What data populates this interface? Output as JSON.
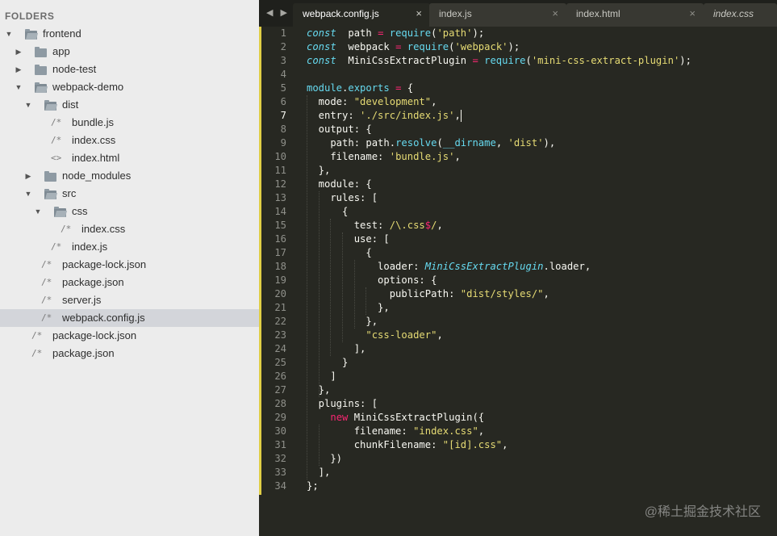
{
  "sidebar": {
    "title": "FOLDERS",
    "tree": [
      {
        "label": "frontend",
        "type": "folder",
        "depth": 0,
        "open": true
      },
      {
        "label": "app",
        "type": "folder",
        "depth": 1,
        "open": false
      },
      {
        "label": "node-test",
        "type": "folder",
        "depth": 1,
        "open": false
      },
      {
        "label": "webpack-demo",
        "type": "folder",
        "depth": 1,
        "open": true
      },
      {
        "label": "dist",
        "type": "folder",
        "depth": 2,
        "open": true
      },
      {
        "label": "bundle.js",
        "type": "file",
        "icon": "/*",
        "depth": 3
      },
      {
        "label": "index.css",
        "type": "file",
        "icon": "/*",
        "depth": 3
      },
      {
        "label": "index.html",
        "type": "file",
        "icon": "<>",
        "depth": 3
      },
      {
        "label": "node_modules",
        "type": "folder",
        "depth": 2,
        "open": false
      },
      {
        "label": "src",
        "type": "folder",
        "depth": 2,
        "open": true
      },
      {
        "label": "css",
        "type": "folder",
        "depth": 3,
        "open": true
      },
      {
        "label": "index.css",
        "type": "file",
        "icon": "/*",
        "depth": 4
      },
      {
        "label": "index.js",
        "type": "file",
        "icon": "/*",
        "depth": 3
      },
      {
        "label": "package-lock.json",
        "type": "file",
        "icon": "/*",
        "depth": 2
      },
      {
        "label": "package.json",
        "type": "file",
        "icon": "/*",
        "depth": 2
      },
      {
        "label": "server.js",
        "type": "file",
        "icon": "/*",
        "depth": 2
      },
      {
        "label": "webpack.config.js",
        "type": "file",
        "icon": "/*",
        "depth": 2,
        "selected": true
      },
      {
        "label": "package-lock.json",
        "type": "file",
        "icon": "/*",
        "depth": 1
      },
      {
        "label": "package.json",
        "type": "file",
        "icon": "/*",
        "depth": 1
      }
    ]
  },
  "tabbar": {
    "nav_arrows": "◀ ▶",
    "tabs": [
      {
        "label": "webpack.config.js",
        "close": "×",
        "active": true
      },
      {
        "label": "index.js",
        "close": "×"
      },
      {
        "label": "index.html",
        "close": "×"
      },
      {
        "label": "index.css",
        "close": "×",
        "italic": true
      }
    ]
  },
  "editor": {
    "current_line": 7,
    "lines": [
      [
        [
          "kw",
          "const"
        ],
        [
          "",
          "  path "
        ],
        [
          "op",
          "="
        ],
        [
          "",
          ""
        ],
        [
          "fn",
          " require"
        ],
        [
          "",
          "("
        ],
        [
          "str",
          "'path'"
        ],
        [
          "",
          ");"
        ]
      ],
      [
        [
          "kw",
          "const"
        ],
        [
          "",
          "  webpack "
        ],
        [
          "op",
          "="
        ],
        [
          "fn",
          " require"
        ],
        [
          "",
          "("
        ],
        [
          "str",
          "'webpack'"
        ],
        [
          "",
          ");"
        ]
      ],
      [
        [
          "kw",
          "const"
        ],
        [
          "",
          "  MiniCssExtractPlugin "
        ],
        [
          "op",
          "="
        ],
        [
          "fn",
          " require"
        ],
        [
          "",
          "("
        ],
        [
          "str",
          "'mini-css-extract-plugin'"
        ],
        [
          "",
          ");"
        ]
      ],
      [],
      [
        [
          "fn",
          "module"
        ],
        [
          "",
          "."
        ],
        [
          "fn",
          "exports"
        ],
        [
          "op",
          " ="
        ],
        [
          "",
          " {"
        ]
      ],
      [
        [
          "",
          "  mode: "
        ],
        [
          "str",
          "\"development\""
        ],
        [
          "",
          ","
        ]
      ],
      [
        [
          "",
          "  entry: "
        ],
        [
          "str",
          "'./src/index.js'"
        ],
        [
          "",
          ","
        ],
        [
          "cursor",
          ""
        ]
      ],
      [
        [
          "",
          "  output: {"
        ]
      ],
      [
        [
          "",
          "    path: path."
        ],
        [
          "fn",
          "resolve"
        ],
        [
          "",
          "("
        ],
        [
          "fn",
          "__dirname"
        ],
        [
          "",
          ", "
        ],
        [
          "str",
          "'dist'"
        ],
        [
          "",
          "),"
        ]
      ],
      [
        [
          "",
          "    filename: "
        ],
        [
          "str",
          "'bundle.js'"
        ],
        [
          "",
          ","
        ]
      ],
      [
        [
          "",
          "  },"
        ]
      ],
      [
        [
          "",
          "  module: {"
        ]
      ],
      [
        [
          "",
          "    rules: ["
        ]
      ],
      [
        [
          "",
          "      {"
        ]
      ],
      [
        [
          "",
          "        test: "
        ],
        [
          "str",
          "/\\."
        ],
        [
          "str",
          "css"
        ],
        [
          "rx",
          "$"
        ],
        [
          "str",
          "/"
        ],
        [
          "",
          ","
        ]
      ],
      [
        [
          "",
          "        use: ["
        ]
      ],
      [
        [
          "",
          "          {"
        ]
      ],
      [
        [
          "",
          "            loader: "
        ],
        [
          "cls",
          "MiniCssExtractPlugin"
        ],
        [
          "",
          ".loader,"
        ]
      ],
      [
        [
          "",
          "            options: {"
        ]
      ],
      [
        [
          "",
          "              publicPath: "
        ],
        [
          "str",
          "\"dist/styles/\""
        ],
        [
          "",
          ","
        ]
      ],
      [
        [
          "",
          "            },"
        ]
      ],
      [
        [
          "",
          "          },"
        ]
      ],
      [
        [
          "",
          "          "
        ],
        [
          "str",
          "\"css-loader\""
        ],
        [
          "",
          ","
        ]
      ],
      [
        [
          "",
          "        ],"
        ]
      ],
      [
        [
          "",
          "      }"
        ]
      ],
      [
        [
          "",
          "    ]"
        ]
      ],
      [
        [
          "",
          "  },"
        ]
      ],
      [
        [
          "",
          "  plugins: ["
        ]
      ],
      [
        [
          "",
          "    "
        ],
        [
          "op",
          "new"
        ],
        [
          "",
          " MiniCssExtractPlugin({"
        ]
      ],
      [
        [
          "",
          "        filename: "
        ],
        [
          "str",
          "\"index.css\""
        ],
        [
          "",
          ","
        ]
      ],
      [
        [
          "",
          "        chunkFilename: "
        ],
        [
          "str",
          "\"[id].css\""
        ],
        [
          "",
          ","
        ]
      ],
      [
        [
          "",
          "    })"
        ]
      ],
      [
        [
          "",
          "  ],"
        ]
      ],
      [
        [
          "",
          "};"
        ]
      ]
    ]
  },
  "watermark": "@稀土掘金技术社区"
}
